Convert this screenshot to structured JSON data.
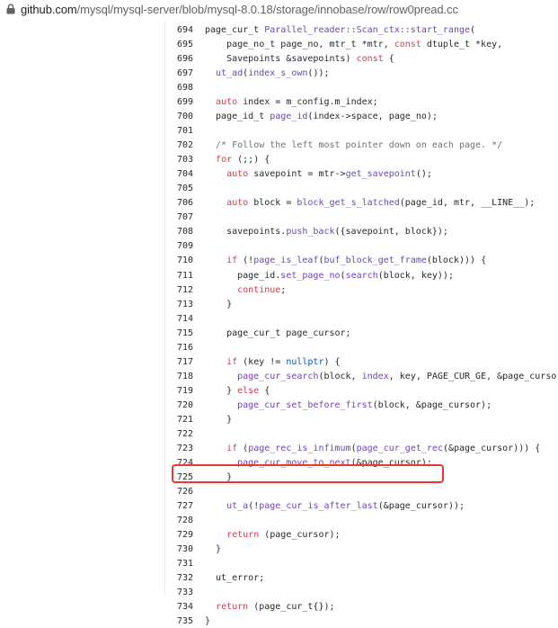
{
  "address_bar": {
    "host": "github.com",
    "path": "/mysql/mysql-server/blob/mysql-8.0.18/storage/innobase/row/row0pread.cc"
  },
  "code": {
    "lines": [
      {
        "n": "694",
        "t": [
          [
            "page_cur_t ",
            ""
          ],
          [
            "Parallel_reader::Scan_ctx::start_range",
            "f"
          ],
          [
            "(",
            ""
          ]
        ]
      },
      {
        "n": "695",
        "t": [
          [
            "    page_no_t page_no, mtr_t *mtr, ",
            ""
          ],
          [
            "const",
            "k"
          ],
          [
            " dtuple_t *key,",
            ""
          ]
        ]
      },
      {
        "n": "696",
        "t": [
          [
            "    Savepoints &savepoints) ",
            ""
          ],
          [
            "const",
            "k"
          ],
          [
            " {",
            ""
          ]
        ]
      },
      {
        "n": "697",
        "t": [
          [
            "  ",
            ""
          ],
          [
            "ut_ad",
            "f"
          ],
          [
            "(",
            ""
          ],
          [
            "index_s_own",
            "f"
          ],
          [
            "());",
            ""
          ]
        ]
      },
      {
        "n": "698",
        "t": []
      },
      {
        "n": "699",
        "t": [
          [
            "  ",
            ""
          ],
          [
            "auto",
            "k"
          ],
          [
            " index = m_config.m_index;",
            ""
          ]
        ]
      },
      {
        "n": "700",
        "t": [
          [
            "  page_id_t ",
            ""
          ],
          [
            "page_id",
            "f"
          ],
          [
            "(index->space, page_no);",
            ""
          ]
        ]
      },
      {
        "n": "701",
        "t": []
      },
      {
        "n": "702",
        "t": [
          [
            "  ",
            ""
          ],
          [
            "/* Follow the left most pointer down on each page. */",
            "c"
          ]
        ]
      },
      {
        "n": "703",
        "t": [
          [
            "  ",
            ""
          ],
          [
            "for",
            "k"
          ],
          [
            " (;;) {",
            ""
          ]
        ]
      },
      {
        "n": "704",
        "t": [
          [
            "    ",
            ""
          ],
          [
            "auto",
            "k"
          ],
          [
            " savepoint = mtr->",
            ""
          ],
          [
            "get_savepoint",
            "f"
          ],
          [
            "();",
            ""
          ]
        ]
      },
      {
        "n": "705",
        "t": []
      },
      {
        "n": "706",
        "t": [
          [
            "    ",
            ""
          ],
          [
            "auto",
            "k"
          ],
          [
            " block = ",
            ""
          ],
          [
            "block_get_s_latched",
            "f"
          ],
          [
            "(page_id, mtr, __LINE__);",
            ""
          ]
        ]
      },
      {
        "n": "707",
        "t": []
      },
      {
        "n": "708",
        "t": [
          [
            "    savepoints.",
            ""
          ],
          [
            "push_back",
            "f"
          ],
          [
            "({savepoint, block});",
            ""
          ]
        ]
      },
      {
        "n": "709",
        "t": []
      },
      {
        "n": "710",
        "t": [
          [
            "    ",
            ""
          ],
          [
            "if",
            "k"
          ],
          [
            " (!",
            ""
          ],
          [
            "page_is_leaf",
            "f"
          ],
          [
            "(",
            ""
          ],
          [
            "buf_block_get_frame",
            "f"
          ],
          [
            "(block))) {",
            ""
          ]
        ]
      },
      {
        "n": "711",
        "t": [
          [
            "      page_id.",
            ""
          ],
          [
            "set_page_no",
            "f"
          ],
          [
            "(",
            ""
          ],
          [
            "search",
            "f"
          ],
          [
            "(block, key));",
            ""
          ]
        ]
      },
      {
        "n": "712",
        "t": [
          [
            "      ",
            ""
          ],
          [
            "continue",
            "k"
          ],
          [
            ";",
            ""
          ]
        ]
      },
      {
        "n": "713",
        "t": [
          [
            "    }",
            ""
          ]
        ]
      },
      {
        "n": "714",
        "t": []
      },
      {
        "n": "715",
        "t": [
          [
            "    page_cur_t page_cursor;",
            ""
          ]
        ]
      },
      {
        "n": "716",
        "t": []
      },
      {
        "n": "717",
        "t": [
          [
            "    ",
            ""
          ],
          [
            "if",
            "k"
          ],
          [
            " (key != ",
            ""
          ],
          [
            "nullptr",
            "n"
          ],
          [
            ") {",
            ""
          ]
        ]
      },
      {
        "n": "718",
        "t": [
          [
            "      ",
            ""
          ],
          [
            "page_cur_search",
            "f"
          ],
          [
            "(block, ",
            ""
          ],
          [
            "index",
            "f"
          ],
          [
            ", key, PAGE_CUR_GE, &page_cursor);",
            ""
          ]
        ]
      },
      {
        "n": "719",
        "t": [
          [
            "    } ",
            ""
          ],
          [
            "else",
            "k"
          ],
          [
            " {",
            ""
          ]
        ]
      },
      {
        "n": "720",
        "t": [
          [
            "      ",
            ""
          ],
          [
            "page_cur_set_before_first",
            "f"
          ],
          [
            "(block, &page_cursor);",
            ""
          ]
        ]
      },
      {
        "n": "721",
        "t": [
          [
            "    }",
            ""
          ]
        ]
      },
      {
        "n": "722",
        "t": []
      },
      {
        "n": "723",
        "t": [
          [
            "    ",
            ""
          ],
          [
            "if",
            "k"
          ],
          [
            " (",
            ""
          ],
          [
            "page_rec_is_infimum",
            "f"
          ],
          [
            "(",
            ""
          ],
          [
            "page_cur_get_rec",
            "f"
          ],
          [
            "(&page_cursor))) {",
            ""
          ]
        ]
      },
      {
        "n": "724",
        "t": [
          [
            "      ",
            ""
          ],
          [
            "page_cur_move_to_next",
            "f"
          ],
          [
            "(&page_cursor);",
            ""
          ]
        ]
      },
      {
        "n": "725",
        "t": [
          [
            "    }",
            ""
          ]
        ]
      },
      {
        "n": "726",
        "t": []
      },
      {
        "n": "727",
        "t": [
          [
            "    ",
            ""
          ],
          [
            "ut_a",
            "f"
          ],
          [
            "(!",
            ""
          ],
          [
            "page_cur_is_after_last",
            "f"
          ],
          [
            "(&page_cursor));",
            ""
          ]
        ]
      },
      {
        "n": "728",
        "t": []
      },
      {
        "n": "729",
        "t": [
          [
            "    ",
            ""
          ],
          [
            "return",
            "k"
          ],
          [
            " (page_cursor);",
            ""
          ]
        ]
      },
      {
        "n": "730",
        "t": [
          [
            "  }",
            ""
          ]
        ]
      },
      {
        "n": "731",
        "t": []
      },
      {
        "n": "732",
        "t": [
          [
            "  ut_error;",
            ""
          ]
        ]
      },
      {
        "n": "733",
        "t": []
      },
      {
        "n": "734",
        "t": [
          [
            "  ",
            ""
          ],
          [
            "return",
            "k"
          ],
          [
            " (page_cur_t{});",
            ""
          ]
        ]
      },
      {
        "n": "735",
        "t": [
          [
            "}",
            ""
          ]
        ]
      }
    ],
    "highlighted_line": "727"
  },
  "colors": {
    "keyword": "#d73a49",
    "function": "#6f42c1",
    "comment": "#6a737d",
    "constant": "#005cc5",
    "highlight_border": "#e8392c"
  }
}
